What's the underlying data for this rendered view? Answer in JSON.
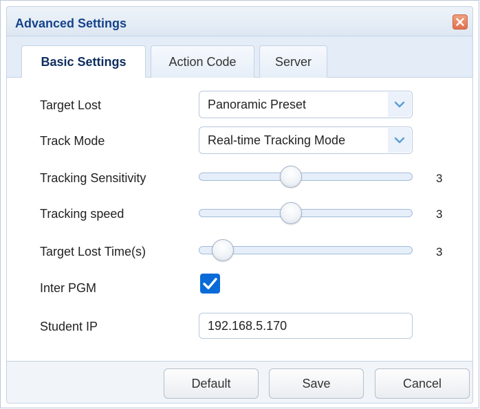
{
  "dialog": {
    "title": "Advanced Settings",
    "close_icon": "close-x-icon"
  },
  "tabs": [
    {
      "label": "Basic Settings",
      "active": true
    },
    {
      "label": "Action Code",
      "active": false
    },
    {
      "label": "Server",
      "active": false
    }
  ],
  "fields": {
    "target_lost": {
      "label": "Target Lost",
      "value": "Panoramic Preset"
    },
    "track_mode": {
      "label": "Track Mode",
      "value": "Real-time Tracking Mode"
    },
    "tracking_sensitivity": {
      "label": "Tracking Sensitivity",
      "value": "3",
      "level": 0.43
    },
    "tracking_speed": {
      "label": "Tracking speed",
      "value": "3",
      "level": 0.43
    },
    "target_lost_time": {
      "label": "Target Lost Time(s)",
      "value": "3",
      "level": 0.11
    },
    "inter_pgm": {
      "label": "Inter PGM",
      "checked": true
    },
    "student_ip": {
      "label": "Student IP",
      "value": "192.168.5.170"
    }
  },
  "buttons": {
    "default": "Default",
    "save": "Save",
    "cancel": "Cancel"
  },
  "colors": {
    "title_text": "#15428b",
    "checkbox_accent": "#0a6bd8",
    "close_button": "#e07050"
  }
}
